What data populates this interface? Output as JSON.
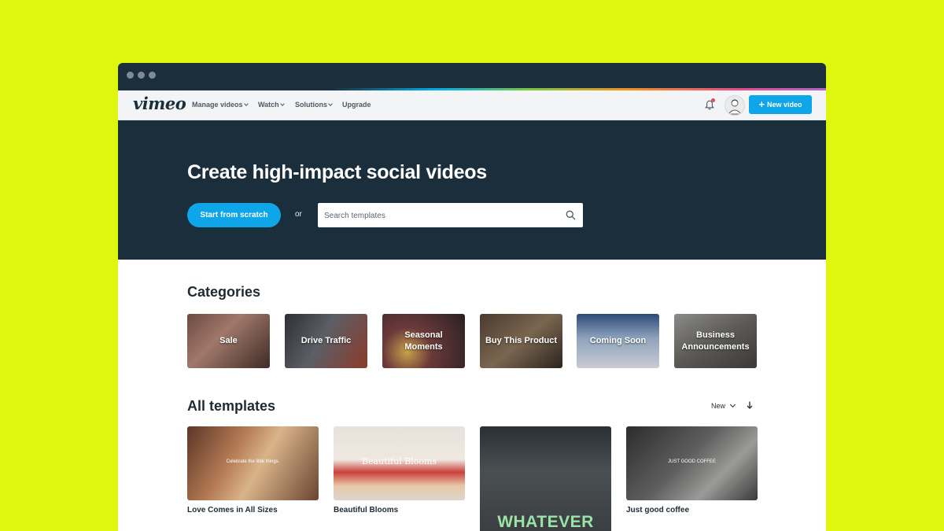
{
  "navbar": {
    "logo": "vimeo",
    "items": [
      {
        "label": "Manage videos"
      },
      {
        "label": "Watch"
      },
      {
        "label": "Solutions"
      },
      {
        "label": "Upgrade"
      }
    ],
    "new_video_label": "New video"
  },
  "hero": {
    "title": "Create high-impact social videos",
    "start_label": "Start from scratch",
    "or_label": "or",
    "search_placeholder": "Search templates"
  },
  "categories": {
    "title": "Categories",
    "items": [
      {
        "label": "Sale"
      },
      {
        "label": "Drive Traffic"
      },
      {
        "label": "Seasonal Moments"
      },
      {
        "label": "Buy This Product"
      },
      {
        "label": "Coming Soon"
      },
      {
        "label": "Business Announcements"
      }
    ]
  },
  "templates": {
    "title": "All templates",
    "sort_label": "New",
    "items": [
      {
        "name": "Love Comes in All Sizes",
        "overlay": "Celebrate the little things."
      },
      {
        "name": "Beautiful Blooms",
        "overlay": "Beautiful Blooms"
      },
      {
        "name": "",
        "overlay": "WHATEVER"
      },
      {
        "name": "Just good coffee",
        "overlay": "JUST GOOD COFFEE"
      }
    ]
  },
  "colors": {
    "page_bg": "#dff70e",
    "hero_bg": "#1a2e3b",
    "accent": "#0ea5e9",
    "notification": "#e5475b"
  },
  "icons": [
    "bell-icon",
    "plus-icon",
    "search-icon",
    "chevron-down-icon",
    "sort-arrow-icon",
    "avatar"
  ]
}
